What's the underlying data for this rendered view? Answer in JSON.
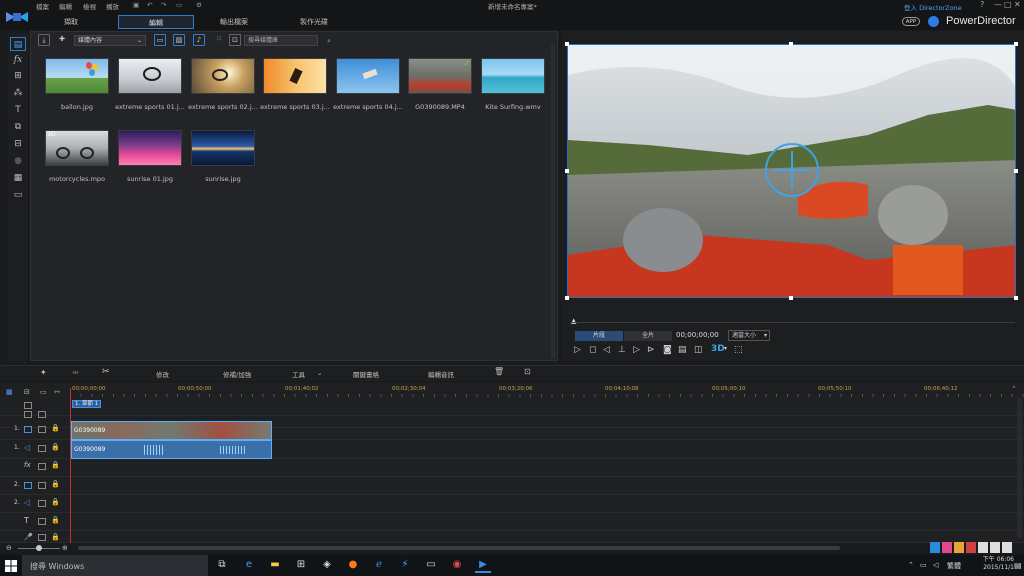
{
  "titlebar": {
    "menus": [
      "檔案",
      "編輯",
      "檢視",
      "播放"
    ],
    "project_title": "新增未命名專案*",
    "window_controls": [
      "?",
      "—",
      "□",
      "✕"
    ]
  },
  "modes": [
    "擷取",
    "編輯",
    "輸出檔案",
    "製作光碟"
  ],
  "brand": {
    "name": "PowerDirector",
    "app_badge": "APP",
    "login": "登入 DirectorZone"
  },
  "library": {
    "filter": "媒體內容",
    "search_placeholder": "搜尋媒體庫",
    "items": [
      {
        "name": "ballon.jpg"
      },
      {
        "name": "extreme sports 01.j..."
      },
      {
        "name": "extreme sports 02.j..."
      },
      {
        "name": "extreme sports 03.j..."
      },
      {
        "name": "extreme sports 04.j..."
      },
      {
        "name": "G0390089.MP4"
      },
      {
        "name": "Kite Surfing.wmv"
      },
      {
        "name": "motorcycles.mpo"
      },
      {
        "name": "sunrise 01.jpg"
      },
      {
        "name": "sunrise.jpg"
      }
    ]
  },
  "preview": {
    "tab_clip": "片段",
    "tab_movie": "全片",
    "timecode": "00;00;00;00",
    "fit": "適當大小",
    "mode_3d": "3D"
  },
  "edit_toolbar": {
    "modify": "修改",
    "fix": "修補/加強",
    "tools": "工具",
    "keyframe": "關鍵畫格",
    "edit_audio": "編輯音訊"
  },
  "timeline": {
    "ticks": [
      "00;00;00;00",
      "00;00;50;00",
      "00;01;40;02",
      "00;02;30;04",
      "00;03;20;06",
      "00;04;10;08",
      "00;05;00;10",
      "00;05;50;10",
      "00;06;40;12"
    ],
    "chapter": "1. 章節 1",
    "video_clip": "G0390089",
    "audio_clip": "G0390089",
    "tracks": [
      "1.",
      "1.",
      "fx",
      "2.",
      "2.",
      "T",
      "🎤",
      "♪"
    ]
  },
  "taskbar": {
    "search": "搜尋 Windows",
    "ime": "繁體",
    "time": "下午 06:06",
    "date": "2015/11/1"
  }
}
